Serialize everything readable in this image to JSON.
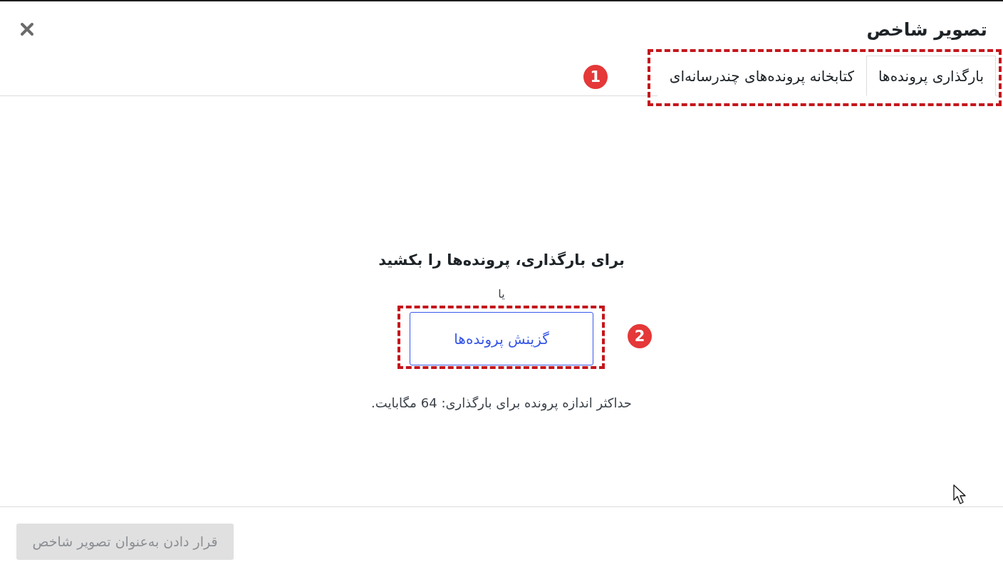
{
  "dialog": {
    "title": "تصویر شاخص"
  },
  "tabs": [
    {
      "label": "بارگذاری پرونده‌ها",
      "selected": true
    },
    {
      "label": "کتابخانه پرونده‌های چندرسانه‌ای",
      "selected": false
    }
  ],
  "tabs_callout": {
    "number": "1"
  },
  "upload": {
    "heading": "برای بارگذاری، پرونده‌ها را بکشید",
    "separator": "یا",
    "button": "گزینش پرونده‌ها",
    "note": "حداکثر اندازه پرونده برای بارگذاری: 64 مگابایت."
  },
  "button_callout": {
    "number": "2"
  },
  "footer": {
    "button": {
      "label": "قرار دادن به‌عنوان تصویر شاخص",
      "disabled": true
    }
  }
}
